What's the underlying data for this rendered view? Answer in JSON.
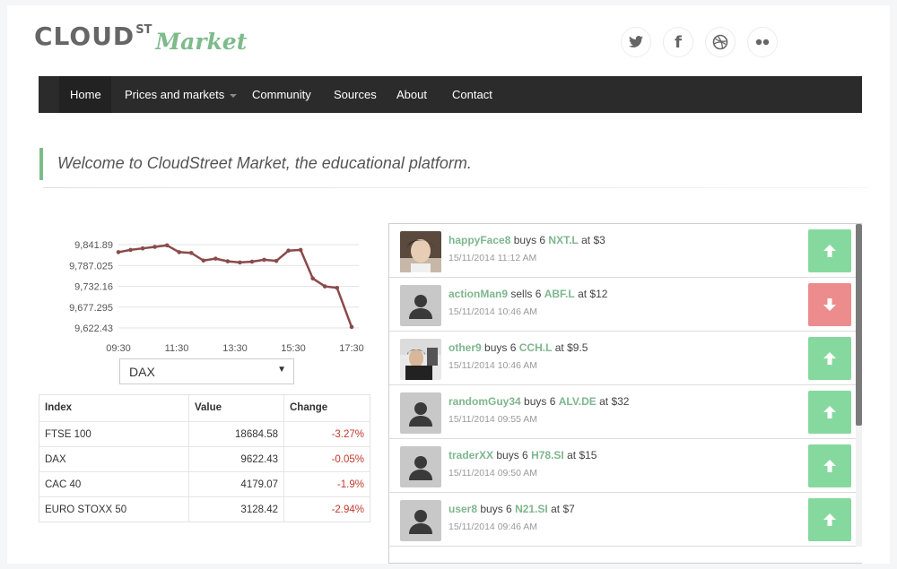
{
  "brand": {
    "cloud": "CLOUD",
    "st": "ST",
    "market": "Market"
  },
  "social": [
    {
      "name": "twitter",
      "icon": "twitter-icon"
    },
    {
      "name": "facebook",
      "icon": "facebook-icon",
      "glyph": "f"
    },
    {
      "name": "dribbble",
      "icon": "dribbble-icon"
    },
    {
      "name": "flickr",
      "icon": "flickr-icon"
    }
  ],
  "nav": {
    "home": "Home",
    "prices": "Prices and markets",
    "community": "Community",
    "sources": "Sources",
    "about": "About",
    "contact": "Contact"
  },
  "welcome": "Welcome to CloudStreet Market, the educational platform.",
  "chart_data": {
    "type": "line",
    "series_color": "#8b4a4a",
    "grid": true,
    "ylim": [
      9622.43,
      9841.89
    ],
    "y_ticks": [
      "9,841.89",
      "9,787.025",
      "9,732.16",
      "9,677.295",
      "9,622.43"
    ],
    "x_ticks": [
      "09:30",
      "11:30",
      "13:30",
      "15:30",
      "17:30"
    ],
    "x_hours": [
      9.5,
      9.917,
      10.333,
      10.75,
      11.167,
      11.583,
      12.0,
      12.417,
      12.833,
      13.25,
      13.667,
      14.083,
      14.5,
      14.917,
      15.333,
      15.75,
      16.167,
      16.583,
      17.0,
      17.5
    ],
    "values": [
      9822,
      9828,
      9832,
      9836,
      9840,
      9822,
      9820,
      9800,
      9805,
      9798,
      9795,
      9797,
      9802,
      9799,
      9826,
      9828,
      9753,
      9732,
      9728,
      9625
    ]
  },
  "selector": {
    "value": "DAX"
  },
  "indices": {
    "headers": [
      "Index",
      "Value",
      "Change"
    ],
    "rows": [
      {
        "name": "FTSE 100",
        "value": "18684.58",
        "change": "-3.27%"
      },
      {
        "name": "DAX",
        "value": "9622.43",
        "change": "-0.05%"
      },
      {
        "name": "CAC 40",
        "value": "4179.07",
        "change": "-1.9%"
      },
      {
        "name": "EURO STOXX 50",
        "value": "3128.42",
        "change": "-2.94%"
      }
    ]
  },
  "activity": [
    {
      "user": "happyFace8",
      "action": "buys 6",
      "ticker": "NXT.L",
      "price": "at $3",
      "time": "15/11/2014 11:12 AM",
      "direction": "up",
      "avatar": "photo-1"
    },
    {
      "user": "actionMan9",
      "action": "sells 6",
      "ticker": "ABF.L",
      "price": "at $12",
      "time": "15/11/2014 10:46 AM",
      "direction": "down",
      "avatar": "default"
    },
    {
      "user": "other9",
      "action": "buys 6",
      "ticker": "CCH.L",
      "price": "at $9.5",
      "time": "15/11/2014 10:46 AM",
      "direction": "up",
      "avatar": "photo-2"
    },
    {
      "user": "randomGuy34",
      "action": "buys 6",
      "ticker": "ALV.DE",
      "price": "at $32",
      "time": "15/11/2014 09:55 AM",
      "direction": "up",
      "avatar": "default"
    },
    {
      "user": "traderXX",
      "action": "buys 6",
      "ticker": "H78.SI",
      "price": "at $15",
      "time": "15/11/2014 09:50 AM",
      "direction": "up",
      "avatar": "default"
    },
    {
      "user": "user8",
      "action": "buys 6",
      "ticker": "N21.SI",
      "price": "at $7",
      "time": "15/11/2014 09:46 AM",
      "direction": "up",
      "avatar": "default"
    }
  ],
  "colors": {
    "accent": "#7dbb8a",
    "navbar": "#2b2b2b",
    "up": "#86d99e",
    "down": "#ec8c8c",
    "negative": "#c0392b"
  }
}
